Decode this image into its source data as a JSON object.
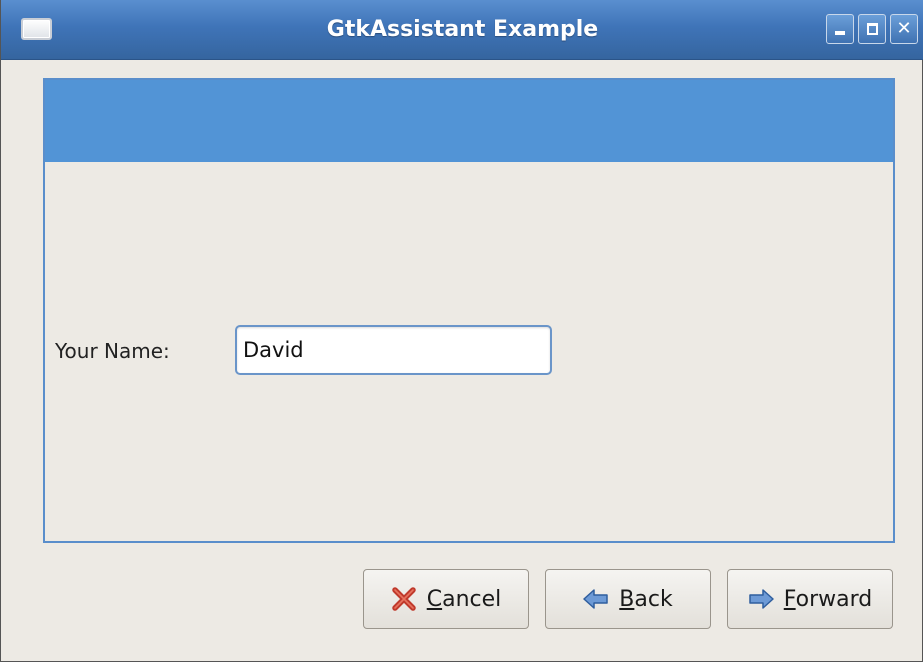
{
  "window": {
    "title": "GtkAssistant Example"
  },
  "page": {
    "name_label": "Your Name:",
    "name_value": "David"
  },
  "buttons": {
    "cancel": {
      "mnemonic": "C",
      "rest": "ancel",
      "icon": "cancel-x-icon"
    },
    "back": {
      "mnemonic": "B",
      "rest": "ack",
      "icon": "back-arrow-icon"
    },
    "forward": {
      "mnemonic": "F",
      "rest": "orward",
      "icon": "forward-arrow-icon"
    }
  },
  "colors": {
    "titlebar": "#3f74b8",
    "header_band": "#5294d6",
    "frame_border": "#5a8ecb",
    "cancel_icon": "#c0392b",
    "arrow_icon": "#4a7bc4"
  }
}
